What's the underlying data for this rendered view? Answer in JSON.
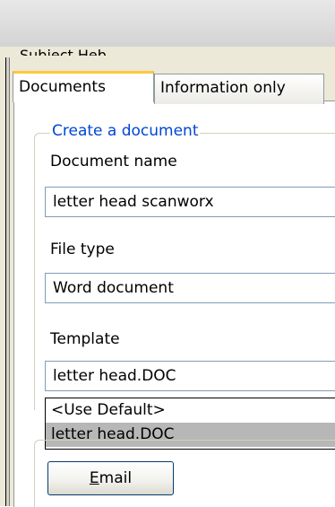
{
  "window": {
    "clipped_label": "Subject Heb"
  },
  "tabs": [
    {
      "label": "Documents",
      "active": true
    },
    {
      "label": "Information only",
      "active": false
    }
  ],
  "create_document": {
    "group_title": "Create a document",
    "document_name_label": "Document name",
    "document_name_value": "letter head scanworx",
    "file_type_label": "File type",
    "file_type_value": "Word document",
    "template_label": "Template",
    "template_value": "letter head.DOC",
    "template_options": [
      "<Use Default>",
      "letter head.DOC"
    ],
    "template_selected_index": 1
  },
  "email_button": {
    "mnemonic": "E",
    "rest": "mail"
  },
  "colors": {
    "group_title": "#0046d5",
    "active_tab_accent": "#ffc83c",
    "selected_option_bg": "#b7b7b7"
  }
}
